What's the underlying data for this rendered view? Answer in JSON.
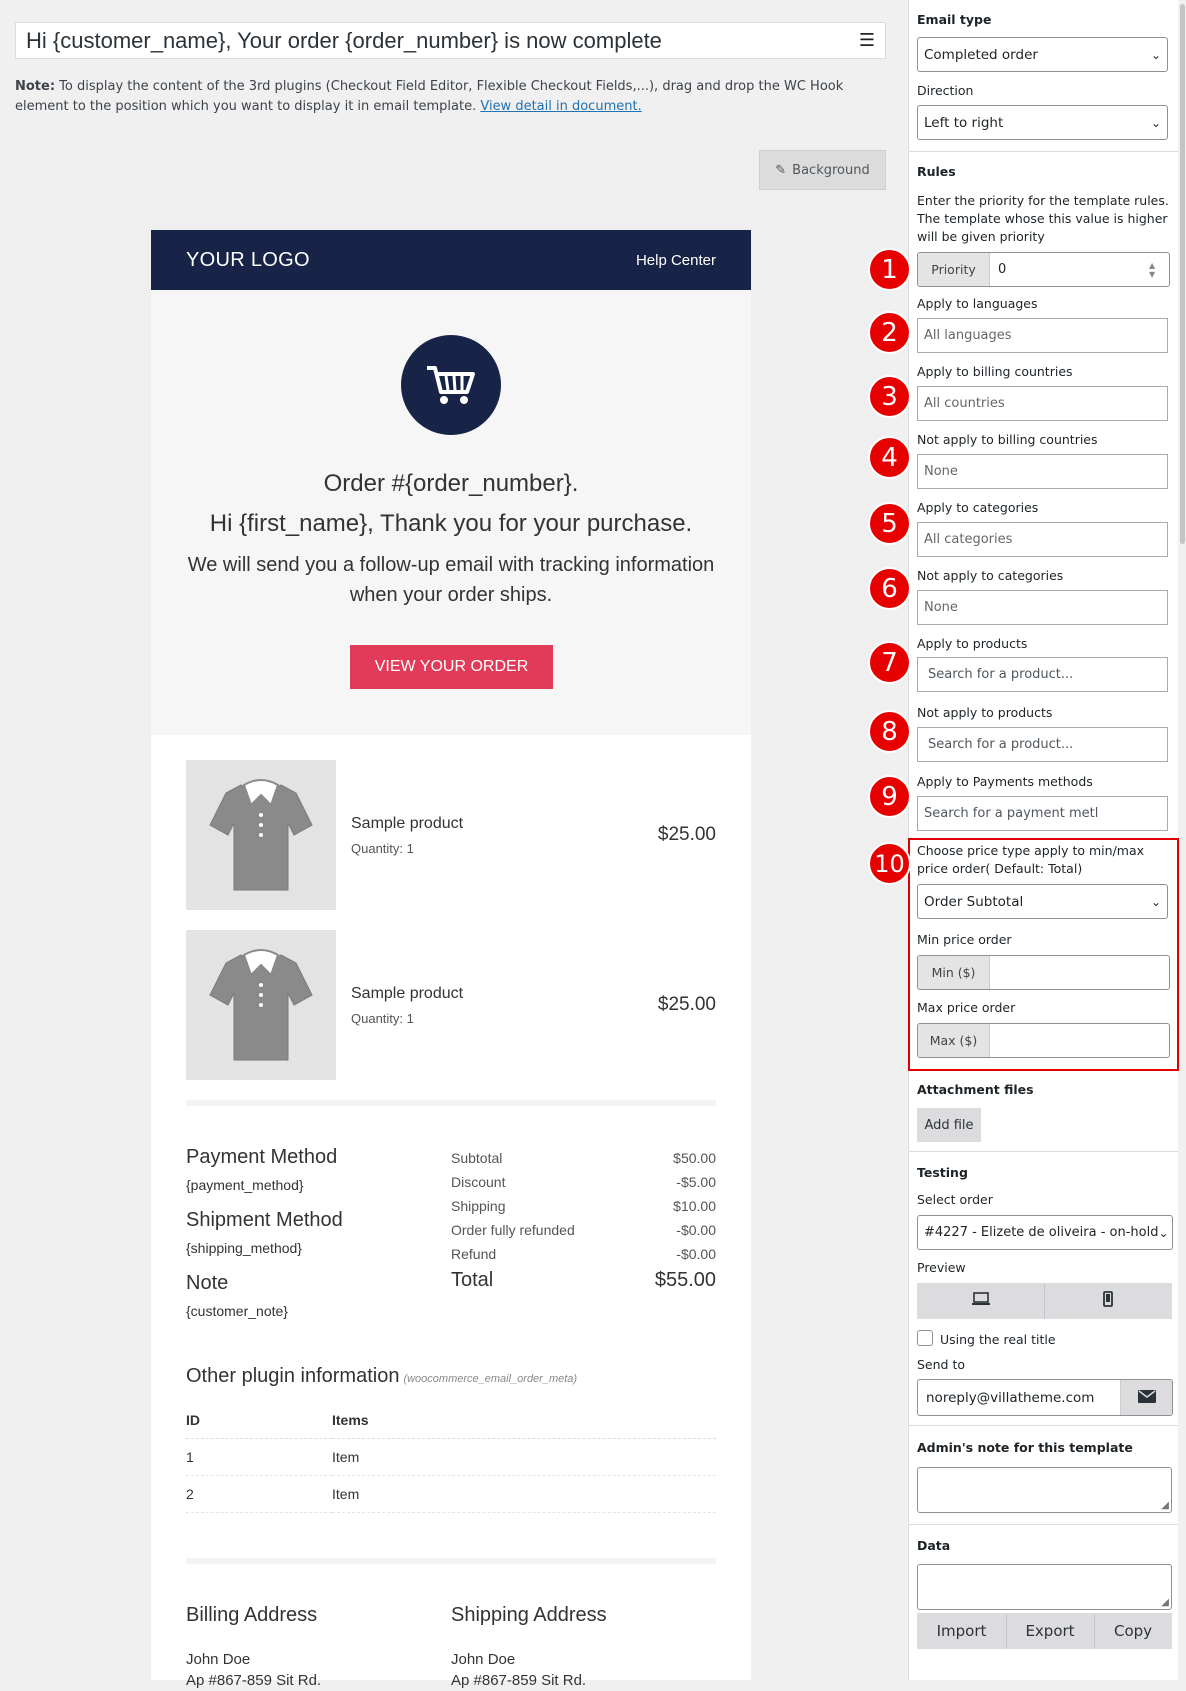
{
  "editor": {
    "email_title": "Hi {customer_name}, Your order {order_number} is now complete",
    "note_label": "Note:",
    "note_text": " To display the content of the 3rd plugins (Checkout Field Editor, Flexible Checkout Fields,...), drag and drop the WC Hook element to the position which you want to display it in email template. ",
    "note_link": "View detail in document.",
    "background_button": "Background"
  },
  "email": {
    "logo": "YOUR LOGO",
    "help_center": "Help Center",
    "order_line": "Order #{order_number}.",
    "greeting": "Hi {first_name}, Thank you for your purchase.",
    "follow_up": "We will send you a follow-up email with tracking information when your order ships.",
    "view_button": "VIEW YOUR ORDER",
    "products": [
      {
        "name": "Sample product",
        "quantity": "Quantity: 1",
        "price": "$25.00"
      },
      {
        "name": "Sample product",
        "quantity": "Quantity: 1",
        "price": "$25.00"
      }
    ],
    "payment_method_heading": "Payment Method",
    "payment_method_value": "{payment_method}",
    "shipment_method_heading": "Shipment Method",
    "shipment_method_value": "{shipping_method}",
    "note_heading": "Note",
    "note_value": "{customer_note}",
    "totals": [
      {
        "label": "Subtotal",
        "value": "$50.00"
      },
      {
        "label": "Discount",
        "value": "-$5.00"
      },
      {
        "label": "Shipping",
        "value": "$10.00"
      },
      {
        "label": "Order fully refunded",
        "value": "-$0.00"
      },
      {
        "label": "Refund",
        "value": "-$0.00"
      }
    ],
    "total_label": "Total",
    "total_value": "$55.00",
    "other_title": "Other plugin information",
    "other_hook": "(woocommerce_email_order_meta)",
    "other_columns": [
      "ID",
      "Items"
    ],
    "other_rows": [
      [
        "1",
        "Item"
      ],
      [
        "2",
        "Item"
      ]
    ],
    "billing_heading": "Billing Address",
    "shipping_heading": "Shipping Address",
    "billing_lines": [
      "John Doe",
      "Ap #867-859 Sit Rd."
    ],
    "shipping_lines": [
      "John Doe",
      "Ap #867-859 Sit Rd."
    ]
  },
  "sidebar": {
    "email_type_label": "Email type",
    "email_type_value": "Completed order",
    "direction_label": "Direction",
    "direction_value": "Left to right",
    "rules_label": "Rules",
    "rules_help": "Enter the priority for the template rules. The template whose this value is higher will be given priority",
    "priority_addon": "Priority",
    "priority_value": "0",
    "languages_label": "Apply to languages",
    "languages_value": "All languages",
    "billing_countries_label": "Apply to billing countries",
    "billing_countries_value": "All countries",
    "not_billing_countries_label": "Not apply to billing countries",
    "not_billing_countries_value": "None",
    "categories_label": "Apply to categories",
    "categories_value": "All categories",
    "not_categories_label": "Not apply to categories",
    "not_categories_value": "None",
    "products_label": "Apply to products",
    "products_placeholder": "Search for a product...",
    "not_products_label": "Not apply to products",
    "not_products_placeholder": "Search for a product...",
    "payment_label": "Apply to Payments methods",
    "payment_placeholder": "Search for a payment metl",
    "price_type_label": "Choose price type apply to min/max price order( Default: Total)",
    "price_type_value": "Order Subtotal",
    "min_label": "Min price order",
    "min_addon": "Min ($)",
    "max_label": "Max price order",
    "max_addon": "Max ($)",
    "attachment_label": "Attachment files",
    "add_file": "Add file",
    "testing_label": "Testing",
    "select_order_label": "Select order",
    "select_order_value": "#4227 - Elizete de oliveira - on-hold",
    "preview_label": "Preview",
    "real_title_label": "Using the real title",
    "send_to_label": "Send to",
    "send_to_value": "noreply@villatheme.com",
    "admin_note_label": "Admin's note for this template",
    "data_label": "Data",
    "import": "Import",
    "export": "Export",
    "copy": "Copy"
  },
  "badges": [
    "1",
    "2",
    "3",
    "4",
    "5",
    "6",
    "7",
    "8",
    "9",
    "10"
  ],
  "colors": {
    "header_bg": "#182447",
    "view_button_bg": "#e23b5a",
    "badge_bg": "#e60000",
    "highlight_border": "#e00000"
  }
}
